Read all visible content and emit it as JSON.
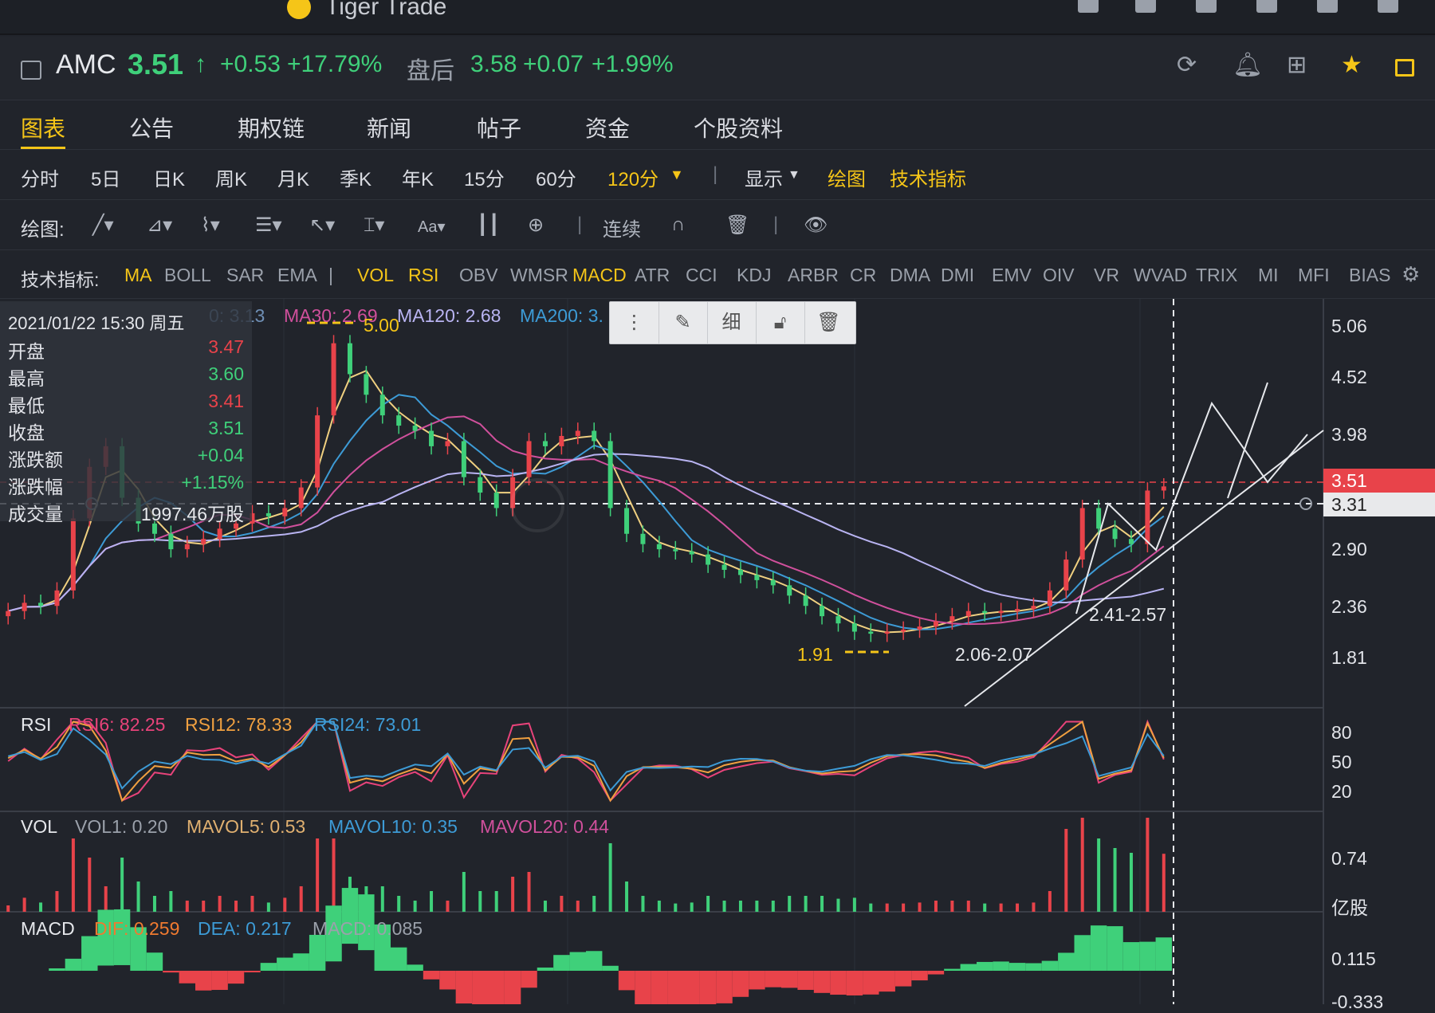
{
  "window": {
    "app_name": "Tiger Trade"
  },
  "quote": {
    "symbol": "AMC",
    "price": "3.51",
    "arrow": "↑",
    "change": "+0.53",
    "change_pct": "+17.79%",
    "after_label": "盘后",
    "after_price": "3.58",
    "after_change": "+0.07",
    "after_pct": "+1.99%"
  },
  "tabs": [
    "图表",
    "公告",
    "期权链",
    "新闻",
    "帖子",
    "资金",
    "个股资料"
  ],
  "periods": [
    "分时",
    "5日",
    "日K",
    "周K",
    "月K",
    "季K",
    "年K",
    "15分",
    "60分"
  ],
  "period_selected": "120分",
  "display_label": "显示",
  "draw_label": "绘图",
  "tech_label": "技术指标",
  "drawbar": {
    "label": "绘图:",
    "continuous": "连续"
  },
  "indicators": {
    "label": "技术指标:",
    "items": [
      "MA",
      "BOLL",
      "SAR",
      "EMA",
      "|",
      "VOL",
      "RSI",
      "OBV",
      "WMSR",
      "MACD",
      "ATR",
      "CCI",
      "KDJ",
      "ARBR",
      "CR",
      "DMA",
      "DMI",
      "EMV",
      "OIV",
      "VR",
      "WVAD",
      "TRIX",
      "MI",
      "MFI",
      "BIAS"
    ],
    "active": [
      "MA",
      "VOL",
      "RSI",
      "MACD"
    ]
  },
  "infobox": {
    "datetime": "2021/01/22 15:30 周五",
    "rows": [
      {
        "k": "开盘",
        "v": "3.47"
      },
      {
        "k": "最高",
        "v": "3.60"
      },
      {
        "k": "最低",
        "v": "3.41"
      },
      {
        "k": "收盘",
        "v": "3.51"
      },
      {
        "k": "涨跌额",
        "v": "+0.04"
      },
      {
        "k": "涨跌幅",
        "v": "+1.15%"
      },
      {
        "k": "成交量",
        "v": "1997.46万股"
      }
    ]
  },
  "ma_legend": {
    "ma_partial": "0: 3.13",
    "ma30": "MA30: 2.69",
    "ma120": "MA120: 2.68",
    "ma200": "MA200: 3."
  },
  "toolbox": {
    "fine": "细"
  },
  "annotations": {
    "high": "5.00",
    "low": "1.91",
    "range1": "2.06-2.07",
    "range2": "2.41-2.57"
  },
  "price_axis": [
    "5.06",
    "4.52",
    "3.98",
    "3.51",
    "3.31",
    "2.90",
    "2.36",
    "1.81"
  ],
  "rsi": {
    "title": "RSI",
    "rsi6": "RSI6: 82.25",
    "rsi12": "RSI12: 78.33",
    "rsi24": "RSI24: 73.01",
    "axis": [
      "80",
      "50",
      "20"
    ]
  },
  "vol": {
    "title": "VOL",
    "vol1": "VOL1: 0.20",
    "mavol5": "MAVOL5: 0.53",
    "mavol10": "MAVOL10: 0.35",
    "mavol20": "MAVOL20: 0.44",
    "axis_value": "0.74",
    "unit": "亿股"
  },
  "macd": {
    "title": "MACD",
    "dif": "DIF: 0.259",
    "dea": "DEA: 0.217",
    "macd": "MACD: 0.085",
    "axis": [
      "0.115",
      "-0.333"
    ]
  },
  "colors": {
    "up": "#e8434a",
    "down": "#3fd07a",
    "accent": "#f5c518",
    "background": "#21242b"
  },
  "chart_data": {
    "type": "candlestick",
    "period": "120分",
    "ylim": [
      1.81,
      5.06
    ],
    "closes": [
      2.3,
      2.38,
      2.35,
      2.5,
      3.2,
      3.7,
      3.9,
      3.4,
      3.15,
      3.05,
      2.9,
      2.95,
      3.0,
      3.1,
      3.15,
      3.25,
      3.22,
      3.3,
      3.5,
      4.2,
      4.9,
      4.6,
      4.4,
      4.2,
      4.1,
      4.05,
      3.9,
      3.95,
      3.6,
      3.45,
      3.3,
      3.6,
      3.95,
      3.9,
      4.0,
      4.05,
      3.95,
      3.3,
      3.05,
      2.95,
      2.9,
      2.88,
      2.85,
      2.75,
      2.7,
      2.65,
      2.6,
      2.55,
      2.45,
      2.35,
      2.25,
      2.18,
      2.1,
      2.08,
      2.1,
      2.12,
      2.15,
      2.2,
      2.25,
      2.3,
      2.28,
      2.3,
      2.32,
      2.35,
      2.5,
      2.8,
      3.3,
      3.1,
      3.0,
      2.95,
      3.47,
      3.51
    ],
    "rsi_last": {
      "rsi6": 82.25,
      "rsi12": 78.33,
      "rsi24": 73.01
    },
    "macd_last": {
      "dif": 0.259,
      "dea": 0.217,
      "macd": 0.085
    }
  }
}
